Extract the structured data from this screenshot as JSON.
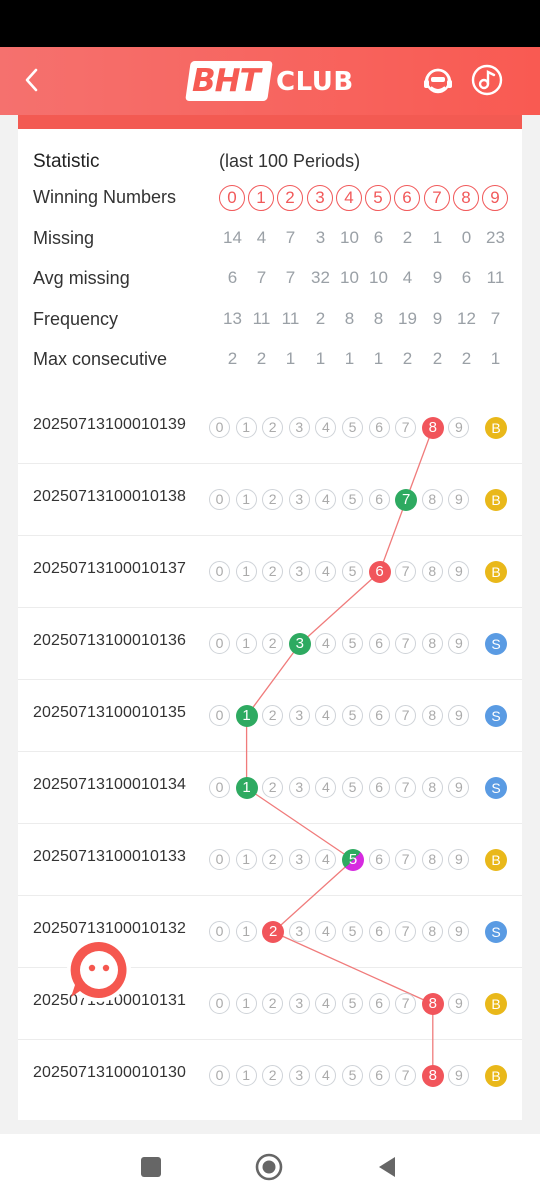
{
  "header": {
    "logo_bht": "BHT",
    "logo_club": "CLUB"
  },
  "statistic": {
    "title": "Statistic",
    "subtitle": "(last 100 Periods)",
    "winning_label": "Winning Numbers",
    "winning_numbers": [
      "0",
      "1",
      "2",
      "3",
      "4",
      "5",
      "6",
      "7",
      "8",
      "9"
    ],
    "rows": [
      {
        "label": "Missing",
        "values": [
          "14",
          "4",
          "7",
          "3",
          "10",
          "6",
          "2",
          "1",
          "0",
          "23"
        ]
      },
      {
        "label": "Avg missing",
        "values": [
          "6",
          "7",
          "7",
          "32",
          "10",
          "10",
          "4",
          "9",
          "6",
          "11"
        ]
      },
      {
        "label": "Frequency",
        "values": [
          "13",
          "11",
          "11",
          "2",
          "8",
          "8",
          "19",
          "9",
          "12",
          "7"
        ]
      },
      {
        "label": "Max consecutive",
        "values": [
          "2",
          "2",
          "1",
          "1",
          "1",
          "1",
          "2",
          "2",
          "2",
          "1"
        ]
      }
    ]
  },
  "history": [
    {
      "period": "20250713100010139",
      "number": 8,
      "color": "red",
      "size": "B"
    },
    {
      "period": "20250713100010138",
      "number": 7,
      "color": "green",
      "size": "B"
    },
    {
      "period": "20250713100010137",
      "number": 6,
      "color": "red",
      "size": "B"
    },
    {
      "period": "20250713100010136",
      "number": 3,
      "color": "green",
      "size": "S"
    },
    {
      "period": "20250713100010135",
      "number": 1,
      "color": "green",
      "size": "S"
    },
    {
      "period": "20250713100010134",
      "number": 1,
      "color": "green",
      "size": "S"
    },
    {
      "period": "20250713100010133",
      "number": 5,
      "color": "mix",
      "size": "B"
    },
    {
      "period": "20250713100010132",
      "number": 2,
      "color": "red",
      "size": "S"
    },
    {
      "period": "20250713100010131",
      "number": 8,
      "color": "red",
      "size": "B"
    },
    {
      "period": "20250713100010130",
      "number": 8,
      "color": "red",
      "size": "B"
    }
  ],
  "colors": {
    "accent": "#f35a52",
    "red": "#f1555b",
    "green": "#2eaa61",
    "violet": "#d62ae0",
    "big": "#e9b81a",
    "small": "#5a9be3"
  }
}
